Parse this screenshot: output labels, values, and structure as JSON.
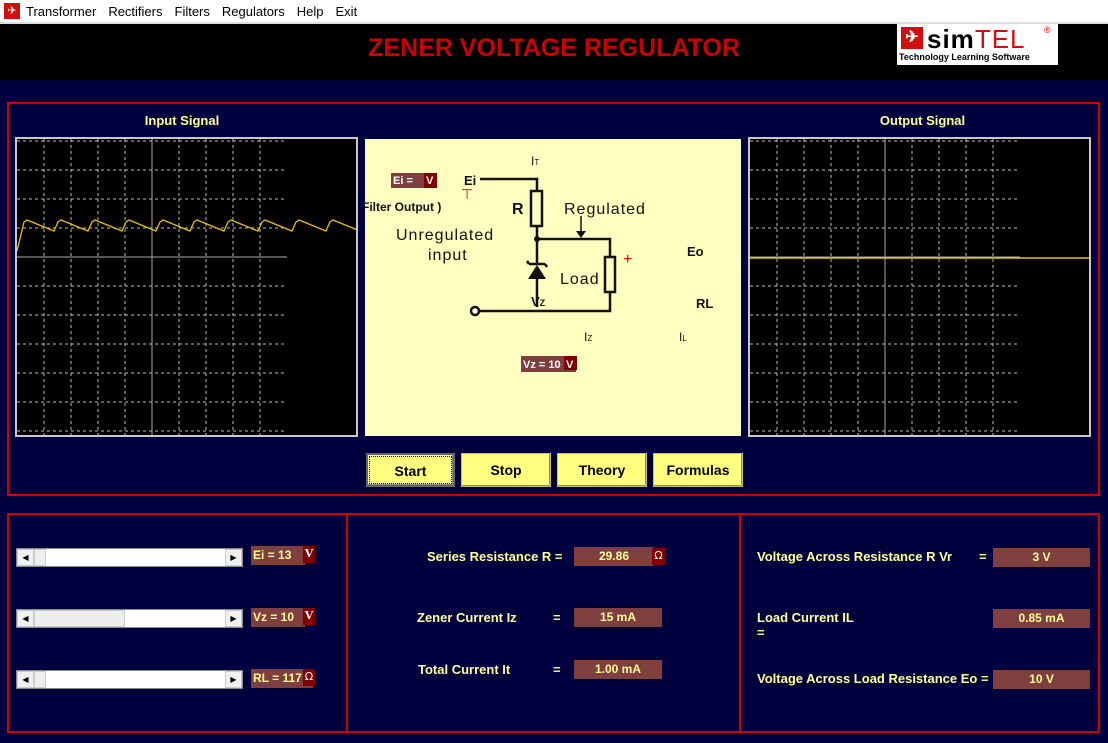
{
  "menu": {
    "items": [
      "Transformer",
      "Rectifiers",
      "Filters",
      "Regulators",
      "Help",
      "Exit"
    ]
  },
  "header": {
    "title": "ZENER VOLTAGE REGULATOR",
    "logo": {
      "word_bold": "sim",
      "word_light": "TEL",
      "tagline": "Technology Learning  Software",
      "reg": "®"
    }
  },
  "colors": {
    "background": "#00003f",
    "border": "#d00000",
    "title": "#c80000",
    "label": "#ffff99",
    "value_box": "#7f3f3f",
    "trace": "#e8c000",
    "diagram_bg": "#ffffc0",
    "button": "#ffff80"
  },
  "scopes": {
    "input_title": "Input Signal",
    "output_title": "Output Signal"
  },
  "diagram": {
    "ei_box": "Ei =",
    "ei_unit": "V",
    "ei_label": "Ei",
    "filter_output": "(Filter Output )",
    "it": "I",
    "it_sub": "T",
    "r": "R",
    "regulated": "Regulated",
    "unregulated1": "Unregulated",
    "unregulated2": "input",
    "load": "Load",
    "plus": "+",
    "eo": "Eo",
    "rl": "RL",
    "vz": "V",
    "vz_sub": "Z",
    "iz": "I",
    "iz_sub": "Z",
    "il": "I",
    "il_sub": "L",
    "vz_box": "Vz = 10",
    "vz_unit": "V"
  },
  "buttons": {
    "start": "Start",
    "stop": "Stop",
    "theory": "Theory",
    "formulas": "Formulas"
  },
  "controls": [
    {
      "label": "Ei = 13",
      "unit": "V",
      "position": 0.0
    },
    {
      "label": "Vz = 10",
      "unit": "V",
      "position": 0.48
    },
    {
      "label": "RL = 117",
      "unit": "Ω",
      "position": 0.0
    }
  ],
  "middle": {
    "series_resistance_label": "Series Resistance  R  =",
    "series_resistance_value": "29.86",
    "series_resistance_unit": "Ω",
    "zener_current_label": "Zener Current  Iz",
    "zener_current_eq": "=",
    "zener_current_value": "15 mA",
    "total_current_label": "Total Current   It",
    "total_current_eq": "=",
    "total_current_value": "1.00 mA"
  },
  "right": {
    "vr_label": "Voltage Across Resistance R    Vr",
    "vr_eq": "=",
    "vr_value": "3 V",
    "il_label": "Load Current  IL",
    "il_eq": "=",
    "il_value": "0.85 mA",
    "eo_label": "Voltage Across Load Resistance Eo =",
    "eo_value": "10 V"
  }
}
